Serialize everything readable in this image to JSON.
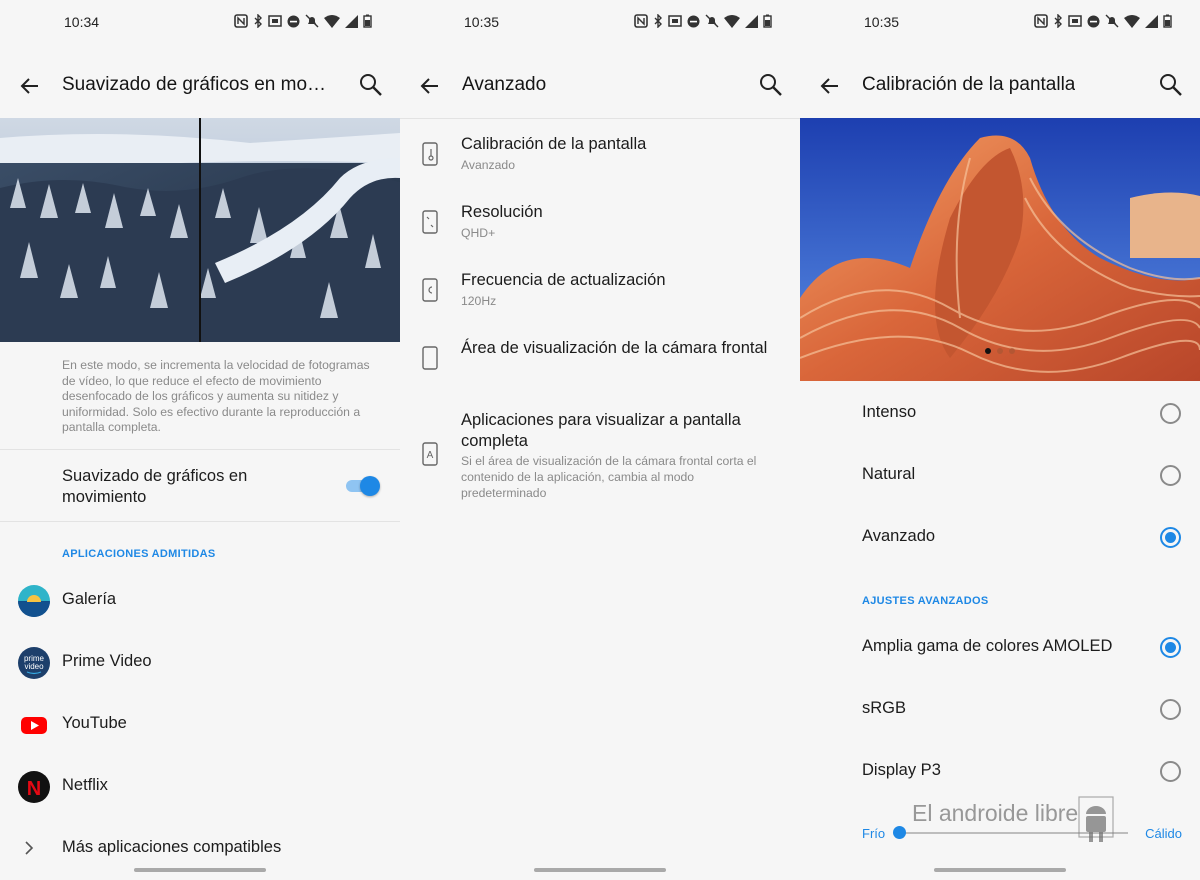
{
  "colors": {
    "accent": "#1e88e5",
    "background": "#f6f6f6",
    "text": "#1c1c1c",
    "secondary_text": "#8a8a8a"
  },
  "screens": [
    {
      "time": "10:34",
      "title": "Suavizado de gráficos en movi...",
      "description": "En este modo, se incrementa la velocidad de fotogramas de vídeo, lo que reduce el efecto de movimiento desenfocado de los gráficos y aumenta su nitidez y uniformidad. Solo es efectivo durante la reproducción a pantalla completa.",
      "toggle": {
        "label": "Suavizado de gráficos en movimiento",
        "on": true
      },
      "section": "APLICACIONES ADMITIDAS",
      "apps": [
        {
          "label": "Galería",
          "icon": "gallery-icon"
        },
        {
          "label": "Prime Video",
          "icon": "prime-video-icon",
          "icon_text": [
            "prime",
            "video"
          ]
        },
        {
          "label": "YouTube",
          "icon": "youtube-icon"
        },
        {
          "label": "Netflix",
          "icon": "netflix-icon",
          "icon_text": "N"
        }
      ],
      "more": "Más aplicaciones compatibles"
    },
    {
      "time": "10:35",
      "title": "Avanzado",
      "items": [
        {
          "title": "Calibración de la pantalla",
          "subtitle": "Avanzado",
          "icon": "thermometer-phone-icon"
        },
        {
          "title": "Resolución",
          "subtitle": "QHD+",
          "icon": "resolution-icon"
        },
        {
          "title": "Frecuencia de actualización",
          "subtitle": "120Hz",
          "icon": "refresh-rate-icon"
        },
        {
          "title": "Área de visualización de la cámara frontal",
          "subtitle": "",
          "icon": "phone-outline-icon"
        },
        {
          "title": "Aplicaciones para visualizar a pantalla completa",
          "subtitle": "Si el área de visualización de la cámara frontal corta el contenido de la aplicación, cambia al modo predeterminado",
          "icon": "fullscreen-app-icon",
          "icon_text": "A"
        }
      ]
    },
    {
      "time": "10:35",
      "title": "Calibración de la pantalla",
      "modes": [
        {
          "label": "Intenso",
          "selected": false
        },
        {
          "label": "Natural",
          "selected": false
        },
        {
          "label": "Avanzado",
          "selected": true
        }
      ],
      "section": "AJUSTES AVANZADOS",
      "advanced": [
        {
          "label": "Amplia gama de colores AMOLED",
          "selected": true
        },
        {
          "label": "sRGB",
          "selected": false
        },
        {
          "label": "Display P3",
          "selected": false
        }
      ],
      "slider": {
        "min_label": "Frío",
        "max_label": "Cálido",
        "value": 0
      },
      "watermark": "El androide libre"
    }
  ]
}
